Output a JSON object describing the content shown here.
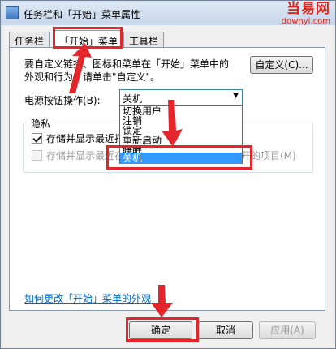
{
  "window": {
    "title": "任务栏和「开始」菜单属性"
  },
  "watermark": {
    "brand": "当易网",
    "site": "downyi.com"
  },
  "tabs": [
    {
      "label": "任务栏"
    },
    {
      "label": "「开始」菜单"
    },
    {
      "label": "工具栏"
    }
  ],
  "start_menu": {
    "description": "要自定义链接、图标和菜单在「开始」菜单中的外观和行为，请单击\"自定义\"。",
    "customize_label": "自定义(C)...",
    "power_label": "电源按钮操作(B):",
    "power_value": "关机",
    "power_options": [
      "切换用户",
      "注销",
      "锁定",
      "重新启动",
      "睡眠",
      "关机"
    ],
    "privacy": {
      "title": "隐私",
      "store_programs": "存储并显示最近打开的程序(P)",
      "store_items": "存储并显示最近在「开始」菜单和任务栏中打开的项目(M)"
    },
    "help_link": "如何更改「开始」菜单的外观"
  },
  "footer": {
    "ok": "确定",
    "cancel": "取消",
    "apply": "应用(A)"
  },
  "colors": {
    "highlight": "#e2262b",
    "selection": "#3399ff",
    "link": "#0066cc"
  }
}
